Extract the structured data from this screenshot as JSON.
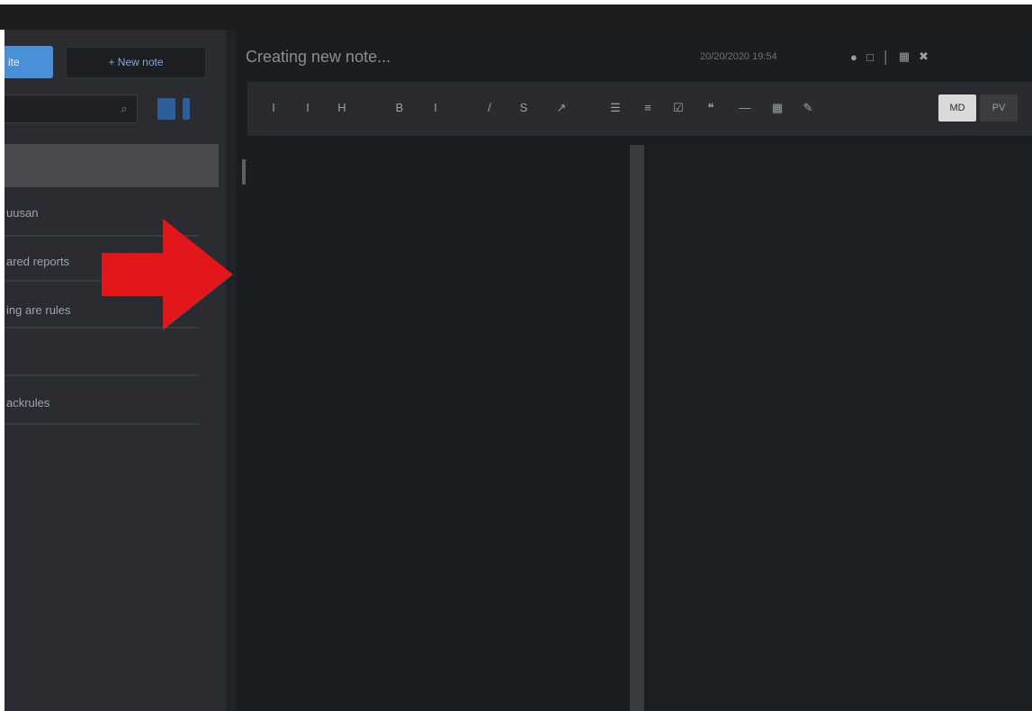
{
  "sidebar": {
    "primary_button": "ite",
    "new_button": "+ New note",
    "search": {
      "placeholder": ""
    },
    "notes": [
      {
        "label": "uusan"
      },
      {
        "label": "ared reports"
      },
      {
        "label": "ing are rules"
      },
      {
        "label": ""
      },
      {
        "label": "ackrules"
      }
    ]
  },
  "editor": {
    "title": "Creating new note...",
    "meta": "20/20/2020 19:54",
    "header_icons": [
      "avatar-icon",
      "save-icon",
      "pin-icon",
      "grid-icon",
      "close-icon"
    ],
    "toolbar": {
      "buttons": [
        "I",
        "I",
        "H",
        "B",
        "I",
        "/",
        "S",
        "↗",
        "☰",
        "≡",
        "☑",
        "❝",
        "—",
        "▦",
        "✎"
      ],
      "mode_edit": "MD",
      "mode_preview": "PV"
    }
  },
  "colors": {
    "accent": "#4a90d9",
    "annotation_arrow": "#e3161c",
    "background": "#1b1e21",
    "sidebar": "#2b2c32"
  }
}
